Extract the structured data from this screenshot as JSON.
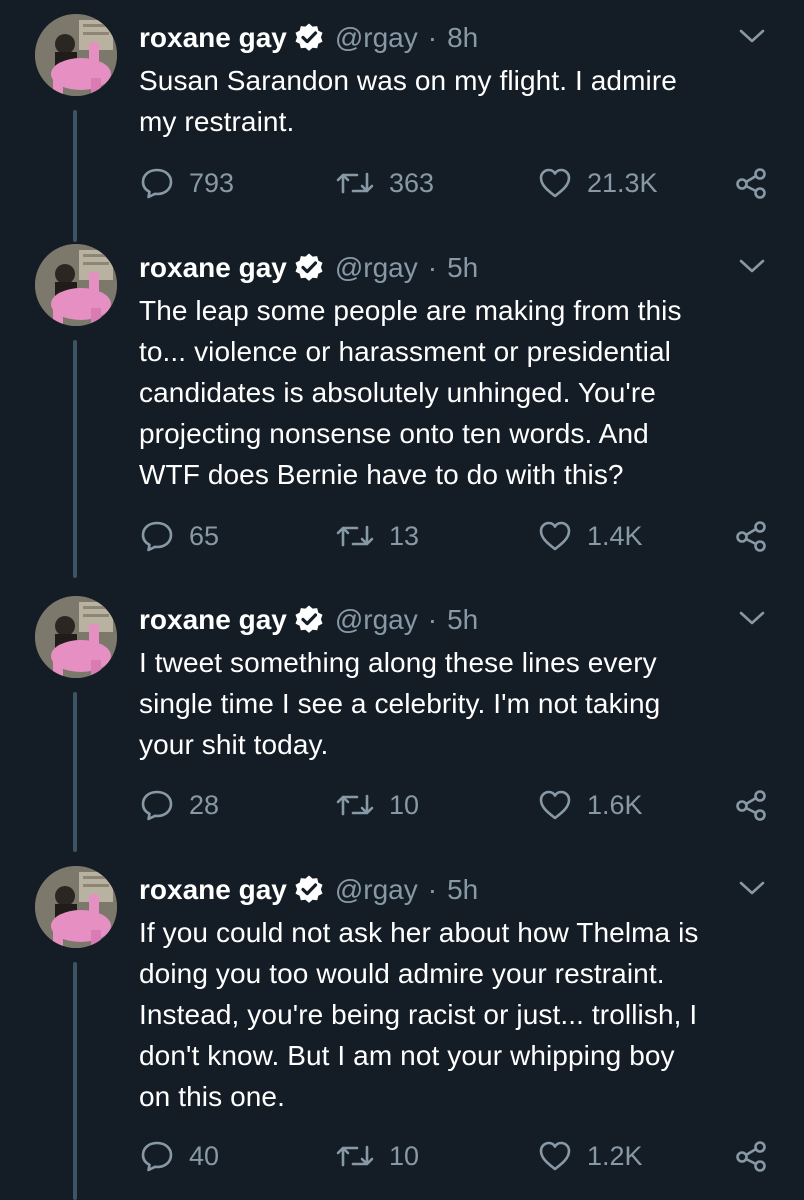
{
  "colors": {
    "background": "#141d26",
    "text": "#ffffff",
    "muted": "#8899a6",
    "verified_badge": "#ffffff",
    "thread_line": "#3d5466"
  },
  "tweets": [
    {
      "author_name": "roxane gay",
      "handle": "@rgay",
      "separator": "·",
      "time": "8h",
      "text": "Susan Sarandon was on my flight. I admire\nmy restraint.",
      "replies": "793",
      "retweets": "363",
      "likes": "21.3K",
      "icons": {
        "reply": "reply-icon",
        "retweet": "retweet-icon",
        "like": "heart-icon",
        "share": "share-icon",
        "menu": "chevron-down-icon",
        "badge": "verified-badge-icon"
      }
    },
    {
      "author_name": "roxane gay",
      "handle": "@rgay",
      "separator": "·",
      "time": "5h",
      "text": "The leap some people are making from this\nto... violence or harassment or presidential\ncandidates is absolutely unhinged. You're\nprojecting nonsense onto ten words. And\nWTF does Bernie have to do with this?",
      "replies": "65",
      "retweets": "13",
      "likes": "1.4K",
      "icons": {
        "reply": "reply-icon",
        "retweet": "retweet-icon",
        "like": "heart-icon",
        "share": "share-icon",
        "menu": "chevron-down-icon",
        "badge": "verified-badge-icon"
      }
    },
    {
      "author_name": "roxane gay",
      "handle": "@rgay",
      "separator": "·",
      "time": "5h",
      "text": "I tweet something along these lines every\nsingle time I see a celebrity. I'm not taking\nyour shit today.",
      "replies": "28",
      "retweets": "10",
      "likes": "1.6K",
      "icons": {
        "reply": "reply-icon",
        "retweet": "retweet-icon",
        "like": "heart-icon",
        "share": "share-icon",
        "menu": "chevron-down-icon",
        "badge": "verified-badge-icon"
      }
    },
    {
      "author_name": "roxane gay",
      "handle": "@rgay",
      "separator": "·",
      "time": "5h",
      "text": "If you could not ask her about how Thelma is\ndoing you too would admire your restraint.\nInstead, you're being racist or just... trollish, I\ndon't know. But I am not your whipping boy\non this one.",
      "replies": "40",
      "retweets": "10",
      "likes": "1.2K",
      "icons": {
        "reply": "reply-icon",
        "retweet": "retweet-icon",
        "like": "heart-icon",
        "share": "share-icon",
        "menu": "chevron-down-icon",
        "badge": "verified-badge-icon"
      }
    }
  ]
}
